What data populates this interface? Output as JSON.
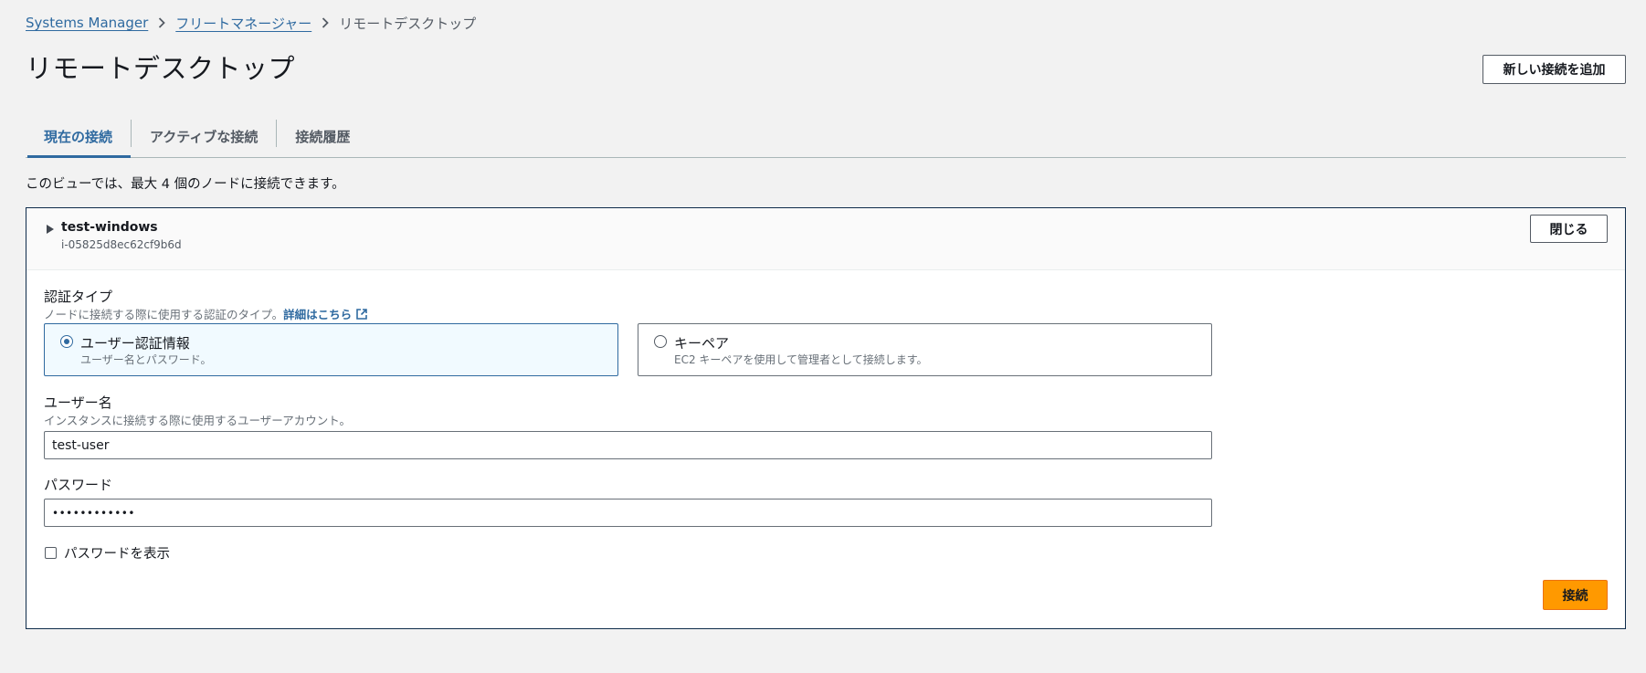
{
  "breadcrumb": {
    "items": [
      "Systems Manager",
      "フリートマネージャー"
    ],
    "current": "リモートデスクトップ"
  },
  "page": {
    "title": "リモートデスクトップ",
    "add_connection_label": "新しい接続を追加"
  },
  "tabs": [
    {
      "label": "現在の接続",
      "active": true
    },
    {
      "label": "アクティブな接続",
      "active": false
    },
    {
      "label": "接続履歴",
      "active": false
    }
  ],
  "intro_text": "このビューでは、最大 4 個のノードに接続できます。",
  "panel": {
    "node_name": "test-windows",
    "node_id": "i-05825d8ec62cf9b6d",
    "close_label": "閉じる",
    "auth": {
      "label": "認証タイプ",
      "description": "ノードに接続する際に使用する認証のタイプ。",
      "learn_more": "詳細はこちら",
      "options": [
        {
          "title": "ユーザー認証情報",
          "description": "ユーザー名とパスワード。",
          "selected": true
        },
        {
          "title": "キーペア",
          "description": "EC2 キーペアを使用して管理者として接続します。",
          "selected": false
        }
      ]
    },
    "username": {
      "label": "ユーザー名",
      "description": "インスタンスに接続する際に使用するユーザーアカウント。",
      "value": "test-user"
    },
    "password": {
      "label": "パスワード",
      "value": "••••••••••••"
    },
    "show_password_label": "パスワードを表示",
    "connect_label": "接続"
  },
  "colors": {
    "accent": "#2f6aa0",
    "primary_button": "#ff9900",
    "background": "#f2f2f2"
  }
}
